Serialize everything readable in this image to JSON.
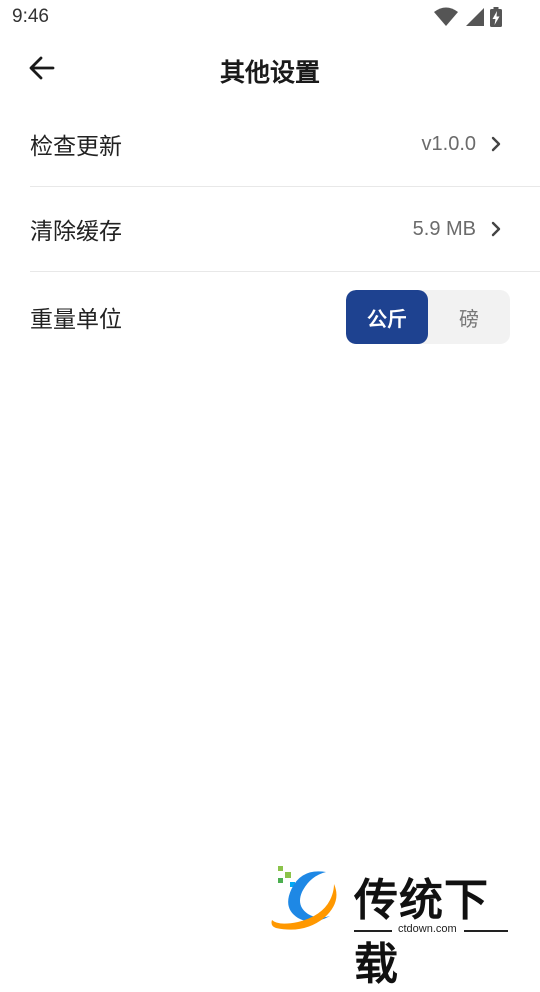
{
  "status_bar": {
    "time": "9:46",
    "icons": [
      "wifi-icon",
      "signal-icon",
      "battery-charging-icon"
    ]
  },
  "app_bar": {
    "title": "其他设置",
    "back_icon": "arrow-left-icon"
  },
  "settings": {
    "check_update": {
      "label": "检查更新",
      "value": "v1.0.0"
    },
    "clear_cache": {
      "label": "清除缓存",
      "value": "5.9 MB"
    },
    "weight_unit": {
      "label": "重量单位",
      "options": [
        "公斤",
        "磅"
      ],
      "selected": "公斤"
    }
  },
  "watermark": {
    "text": "传统下载",
    "subtext": "ctdown.com"
  },
  "colors": {
    "accent": "#1e4290",
    "segment_bg": "#f2f2f2",
    "divider": "#e8e8e8",
    "value_text": "#6b6b6b"
  }
}
